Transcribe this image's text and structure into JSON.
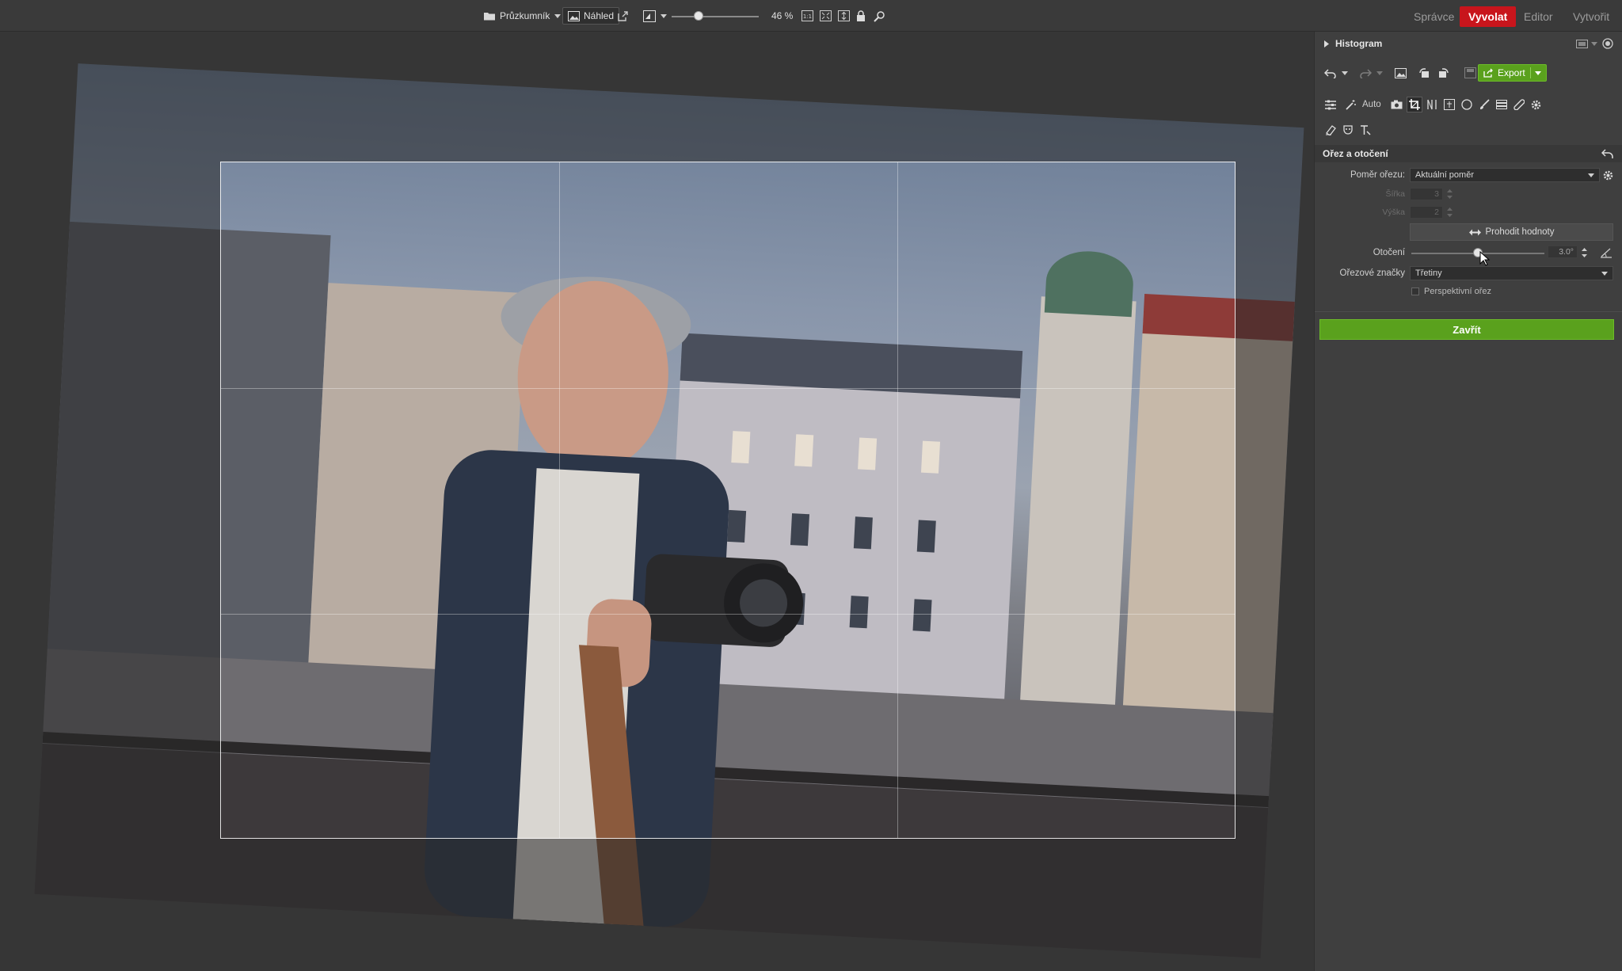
{
  "topbar": {
    "explorer_label": "Průzkumník",
    "preview_label": "Náhled",
    "zoom": "46 %",
    "zoom_fraction": 0.28,
    "tabs": [
      {
        "label": "Správce",
        "active": false
      },
      {
        "label": "Vyvolat",
        "active": true
      },
      {
        "label": "Editor",
        "active": false
      },
      {
        "label": "Vytvořit",
        "active": false
      }
    ],
    "accent_color": "#c8151c"
  },
  "panel": {
    "histogram_title": "Histogram",
    "export_label": "Export",
    "auto_label": "Auto",
    "section_title": "Ořez a otočení",
    "ratio_label": "Poměr ořezu:",
    "ratio_value": "Aktuální poměr",
    "width_label": "Šířka",
    "width_value": "3",
    "height_label": "Výška",
    "height_value": "2",
    "swap_label": "Prohodit hodnoty",
    "rotation_label": "Otočení",
    "rotation_value": "3.0°",
    "rotation_fraction": 0.5,
    "marks_label": "Ořezové značky",
    "marks_value": "Třetiny",
    "perspective_label": "Perspektivní ořez",
    "close_label": "Zavřít",
    "primary_color": "#5aa11d"
  },
  "canvas": {
    "rotation_deg": 3.0,
    "crop_guides": "Třetiny"
  }
}
